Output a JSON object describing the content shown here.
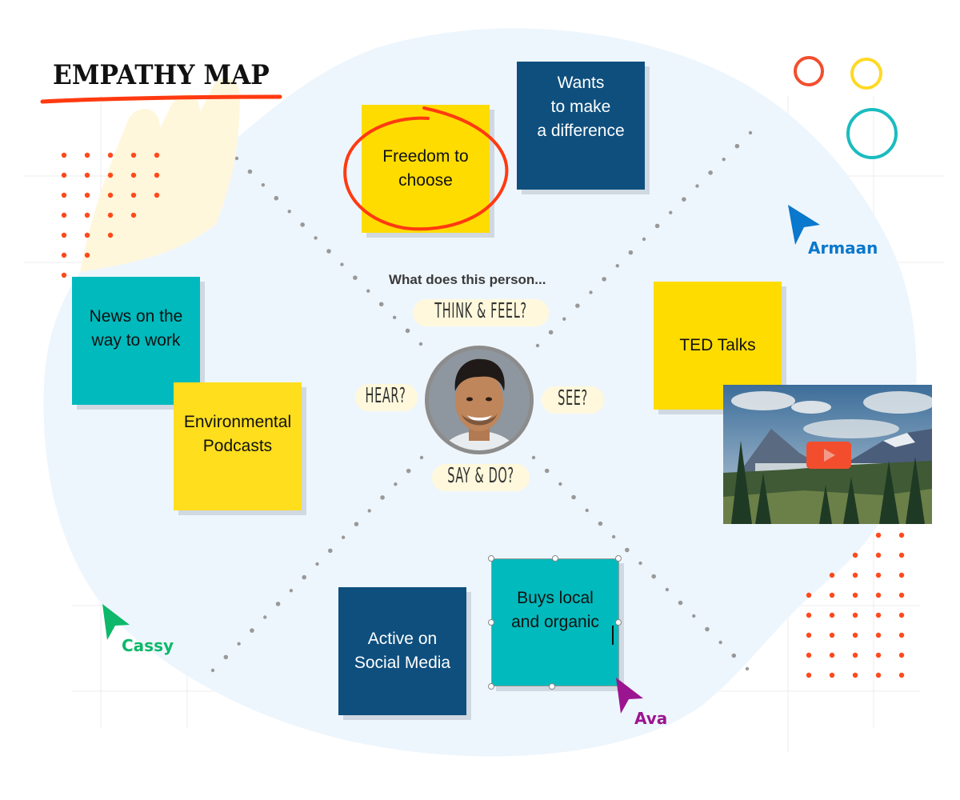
{
  "board": {
    "title": "EMPATHY MAP",
    "question": "What does this person...",
    "quadrants": {
      "think_feel": "THINK & FEEL?",
      "hear": "HEAR?",
      "see": "SEE?",
      "say_do": "SAY & DO?"
    }
  },
  "notes": [
    {
      "id": "freedom",
      "text": "Freedom to\nchoose",
      "color": "yellow",
      "circled": true
    },
    {
      "id": "wants",
      "text": "Wants\nto make\na difference",
      "color": "navy"
    },
    {
      "id": "news",
      "text": "News on the\nway to work",
      "color": "teal"
    },
    {
      "id": "podcasts",
      "text": "Environmental\nPodcasts",
      "color": "yellow"
    },
    {
      "id": "ted",
      "text": "TED Talks",
      "color": "yellow"
    },
    {
      "id": "social",
      "text": "Active on\nSocial Media",
      "color": "navy"
    },
    {
      "id": "buys",
      "text": "Buys local\nand organic",
      "color": "teal",
      "selected": true,
      "editing": true
    }
  ],
  "collaborators": [
    {
      "name": "Armaan",
      "color": "#0A78CC"
    },
    {
      "name": "Cassy",
      "color": "#0DB86A"
    },
    {
      "name": "Ava",
      "color": "#9C1590"
    }
  ],
  "video": {
    "icon": "play-icon",
    "thumbnail": "mountain-landscape"
  },
  "colors": {
    "yellow": "#FFDC00",
    "teal": "#00BABD",
    "navy": "#0E4F7E",
    "accent_red": "#FF4A1C",
    "blob": "#EEF6FD",
    "prompt_bg": "#FFF8DC",
    "circle_red": "#F24E2E",
    "circle_yellow": "#FFD923",
    "circle_teal": "#1ABCBF"
  }
}
